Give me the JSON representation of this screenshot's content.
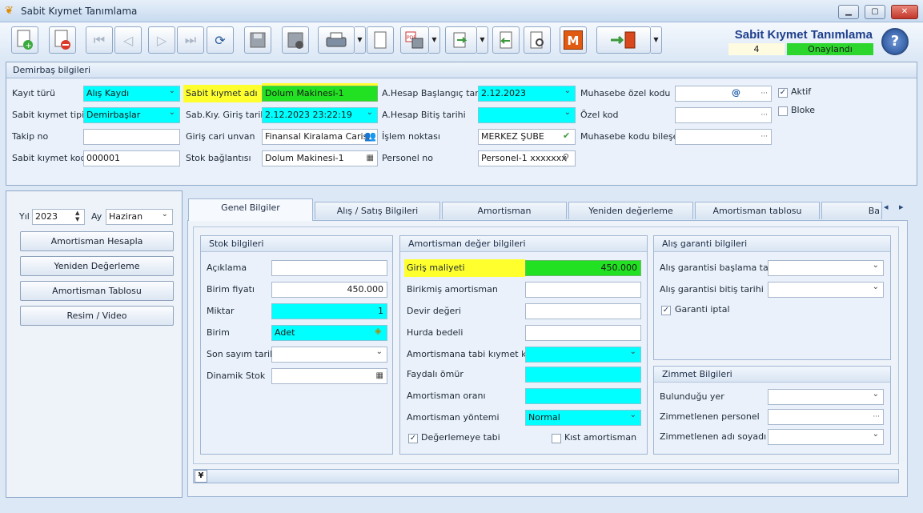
{
  "window": {
    "title": "Sabit Kıymet Tanımlama",
    "min": "▁",
    "max": "▢",
    "close": "✕"
  },
  "header": {
    "title": "Sabit Kıymet Tanımlama",
    "number": "4",
    "status": "Onaylandı",
    "help": "?"
  },
  "toolbar": {
    "icons": [
      "new-document-icon",
      "delete-document-icon",
      "first-record-icon",
      "previous-record-icon",
      "next-record-icon",
      "last-record-icon",
      "refresh-icon",
      "save-icon",
      "save-close-icon",
      "print-icon",
      "blank-page-icon",
      "pdf-export-icon",
      "export-icon",
      "back-icon",
      "settings-icon",
      "m-icon",
      "exit-door-icon"
    ],
    "m_label": "M"
  },
  "demirbas": {
    "header": "Demirbaş bilgileri",
    "kayit_turu_label": "Kayıt türü",
    "kayit_turu": "Alış Kaydı",
    "sk_tipi_label": "Sabit kıymet tipi",
    "sk_tipi": "Demirbaşlar",
    "takip_no_label": "Takip no",
    "takip_no": "",
    "sk_kodu_label": "Sabit kıymet kodu",
    "sk_kodu": "000001",
    "sk_adi_label": "Sabit kıymet adı",
    "sk_adi": "Dolum Makinesi-1",
    "giris_tarihi_label": "Sab.Kıy. Giriş tarihi",
    "giris_tarihi": "2.12.2023 23:22:19",
    "cari_label": "Giriş cari unvan",
    "cari": "Finansal Kiralama Carisi",
    "stok_label": "Stok bağlantısı",
    "stok": "Dolum Makinesi-1",
    "ahesap_bas_label": "A.Hesap Başlangıç tarihi",
    "ahesap_bas": "2.12.2023",
    "ahesap_bit_label": "A.Hesap Bitiş tarihi",
    "ahesap_bit": "",
    "islem_label": "İşlem noktası",
    "islem": "MERKEZ ŞUBE",
    "personel_label": "Personel no",
    "personel": "Personel-1 xxxxxxx",
    "muh_ozel_label": "Muhasebe özel kodu",
    "muh_ozel": "",
    "ozel_kod_label": "Özel kod",
    "ozel_kod": "",
    "muh_bilesen_label": "Muhasebe kodu bileşeni",
    "muh_bilesen": "",
    "aktif_label": "Aktif",
    "aktif": true,
    "bloke_label": "Bloke",
    "bloke": false
  },
  "left": {
    "yil_label": "Yıl",
    "yil": "2023",
    "ay_label": "Ay",
    "ay": "Haziran",
    "btn1": "Amortisman Hesapla",
    "btn2": "Yeniden Değerleme",
    "btn3": "Amortisman Tablosu",
    "btn4": "Resim / Video"
  },
  "tabs": [
    "Genel Bilgiler",
    "Alış / Satış Bilgileri",
    "Amortisman",
    "Yeniden değerleme",
    "Amortisman tablosu",
    "Ba"
  ],
  "stok": {
    "header": "Stok bilgileri",
    "aciklama_label": "Açıklama",
    "aciklama": "",
    "birim_fiyati_label": "Birim fiyatı",
    "birim_fiyati": "450.000",
    "miktar_label": "Miktar",
    "miktar": "1",
    "birim_label": "Birim",
    "birim": "Adet",
    "son_sayim_label": "Son sayım tarihi",
    "son_sayim": "",
    "dinamik_label": "Dinamik Stok",
    "dinamik": ""
  },
  "amort": {
    "header": "Amortisman değer bilgileri",
    "giris_label": "Giriş maliyeti",
    "giris": "450.000",
    "birikmis_label": "Birikmiş amortisman",
    "birikmis": "",
    "devir_label": "Devir değeri",
    "devir": "",
    "hurda_label": "Hurda bedeli",
    "hurda": "",
    "tabi_kod_label": "Amortismana tabi kıymet kodu",
    "tabi_kod": "",
    "faydali_label": "Faydalı ömür",
    "faydali": "",
    "oran_label": "Amortisman oranı",
    "oran": "",
    "yontem_label": "Amortisman yöntemi",
    "yontem": "Normal",
    "degerlemeye_label": "Değerlemeye tabi",
    "degerlemeye": true,
    "kist_label": "Kıst amortisman",
    "kist": false
  },
  "garanti": {
    "header": "Alış garanti bilgileri",
    "bas_label": "Alış garantisi başlama tarihi",
    "bas": "",
    "bit_label": "Alış garantisi bitiş tarihi",
    "bit": "",
    "iptal_label": "Garanti iptal",
    "iptal": true
  },
  "zimmet": {
    "header": "Zimmet Bilgileri",
    "yer_label": "Bulunduğu yer",
    "yer": "",
    "personel_label": "Zimmetlenen personel",
    "personel": "",
    "adi_label": "Zimmetlenen adı soyadı",
    "adi": ""
  },
  "tab_nav": {
    "prev": "◂",
    "next": "▸"
  },
  "expander": "¥"
}
